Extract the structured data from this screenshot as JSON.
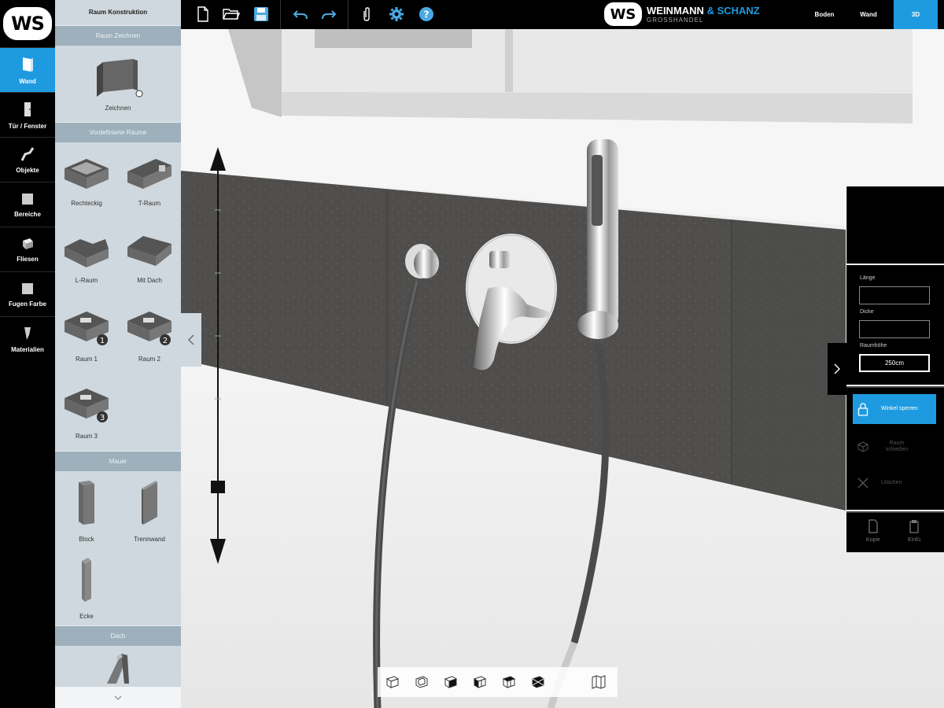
{
  "app": {
    "logo_text": "WS",
    "brand": {
      "name": "WEINMANN",
      "name_accent": "& SCHANZ",
      "tagline": "GROSSHANDEL"
    }
  },
  "nav": {
    "items": [
      {
        "label": "Wand",
        "icon": "wall-icon",
        "active": true
      },
      {
        "label": "Tür / Fenster",
        "icon": "door-icon",
        "active": false
      },
      {
        "label": "Objekte",
        "icon": "faucet-icon",
        "active": false
      },
      {
        "label": "Bereiche",
        "icon": "area-icon",
        "active": false
      },
      {
        "label": "Fliesen",
        "icon": "tile-icon",
        "active": false
      },
      {
        "label": "Fugen Farbe",
        "icon": "grout-color-icon",
        "active": false
      },
      {
        "label": "Materialien",
        "icon": "material-icon",
        "active": false
      }
    ]
  },
  "panel": {
    "title": "Raum Konstruktion",
    "section_draw": "Raum Zeichnen",
    "draw_tile": "Zeichnen",
    "section_predefined": "Vordefinierte Räume",
    "rooms": [
      "Rechteckig",
      "T-Raum",
      "L-Raum",
      "Mit Dach",
      "Raum 1",
      "Raum 2",
      "Raum 3"
    ],
    "section_wall": "Mauer",
    "walls": [
      "Block",
      "Trennwand",
      "Ecke"
    ],
    "section_roof": "Dach"
  },
  "topbar": {
    "tools": [
      "new-file-icon",
      "open-folder-icon",
      "save-icon",
      "undo-icon",
      "redo-icon",
      "attach-icon",
      "settings-icon",
      "help-icon"
    ],
    "views": [
      {
        "label": "Boden",
        "active": false
      },
      {
        "label": "Wand",
        "active": false
      },
      {
        "label": "3D",
        "active": true
      }
    ]
  },
  "right_panel": {
    "laenge_label": "Länge",
    "laenge_value": "",
    "dicke_label": "Dicke",
    "dicke_value": "",
    "raumhoehe_label": "Raumhöhe",
    "raumhoehe_value": "250cm",
    "actions": [
      {
        "label": "Winkel sperren",
        "icon": "lock-icon",
        "active": true
      },
      {
        "label": "Raum schießen",
        "icon": "cube-icon",
        "active": false
      },
      {
        "label": "Löschen",
        "icon": "close-icon",
        "active": false
      }
    ],
    "bottom": [
      {
        "label": "Kopie",
        "icon": "copy-icon"
      },
      {
        "label": "Einfü",
        "icon": "paste-icon"
      }
    ]
  },
  "viewbar": {
    "buttons": [
      "view-front-icon",
      "view-back-icon",
      "view-left-icon",
      "view-right-icon",
      "view-top-icon",
      "view-iso-icon",
      "map-icon"
    ]
  },
  "colors": {
    "accent": "#1e9be0",
    "panel": "#cfd8de",
    "section": "#9db0bb"
  }
}
